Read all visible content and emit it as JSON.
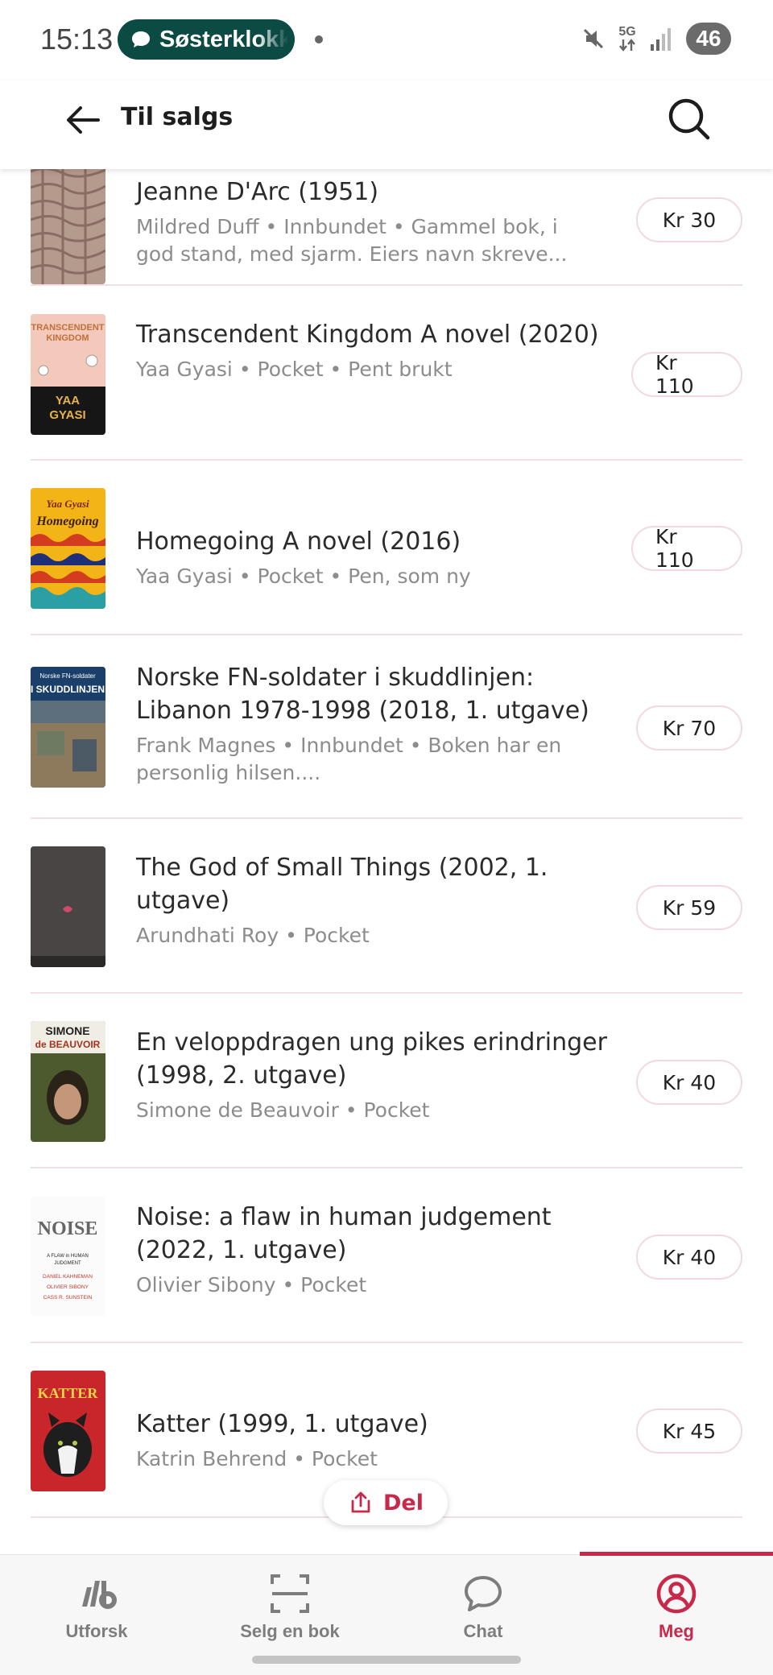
{
  "status_bar": {
    "time": "15:13",
    "notification_app": "Søsterklokken",
    "network": "5G",
    "battery": "46"
  },
  "header": {
    "title": "Til salgs"
  },
  "listings": [
    {
      "title": "Jeanne D'Arc (1951)",
      "meta": "Mildred Duff • Innbundet • Gammel bok, i god stand, med sjarm. Eiers navn skreve...",
      "price": "Kr 30",
      "cover": "jeanne-darc-cover"
    },
    {
      "title": "Transcendent Kingdom A novel (2020)",
      "meta": "Yaa Gyasi • Pocket • Pent brukt",
      "price": "Kr 110",
      "cover": "transcendent-kingdom-cover",
      "cover_text": [
        "TRANSCENDENT",
        "KINGDOM",
        "YAA",
        "GYASI"
      ]
    },
    {
      "title": "Homegoing A novel (2016)",
      "meta": "Yaa Gyasi • Pocket • Pen, som ny",
      "price": "Kr 110",
      "cover": "homegoing-cover",
      "cover_text": [
        "Yaa Gyasi",
        "Homegoing"
      ]
    },
    {
      "title": "Norske FN-soldater i skuddlinjen: Libanon 1978-1998 (2018, 1. utgave)",
      "meta": "Frank Magnes • Innbundet • Boken har en personlig hilsen....",
      "price": "Kr 70",
      "cover": "norske-fn-soldater-cover",
      "cover_text": [
        "Norske FN-soldater",
        "I SKUDDLINJEN"
      ]
    },
    {
      "title": "The God of Small Things (2002, 1. utgave)",
      "meta": "Arundhati Roy • Pocket",
      "price": "Kr 59",
      "cover": "god-of-small-things-cover"
    },
    {
      "title": "En veloppdragen ung pikes erindringer (1998, 2. utgave)",
      "meta": "Simone de Beauvoir • Pocket",
      "price": "Kr 40",
      "cover": "simone-de-beauvoir-cover",
      "cover_text": [
        "SIMONE",
        "de BEAUVOIR"
      ]
    },
    {
      "title": "Noise: a flaw in human judgement (2022, 1. utgave)",
      "meta": "Olivier Sibony • Pocket",
      "price": "Kr 40",
      "cover": "noise-cover",
      "cover_text": [
        "NOISE",
        "A FLAW in HUMAN",
        "JUDGMENT",
        "DANIEL KAHNEMAN",
        "OLIVIER SIBONY",
        "CASS R. SUNSTEIN"
      ]
    },
    {
      "title": "Katter (1999, 1. utgave)",
      "meta": "Katrin Behrend • Pocket",
      "price": "Kr 45",
      "cover": "katter-cover",
      "cover_text": [
        "KATTER"
      ]
    }
  ],
  "share_button": {
    "label": "Del",
    "icon": "share-icon"
  },
  "bottom_nav": [
    {
      "label": "Utforsk",
      "icon": "logo-icon",
      "active": false
    },
    {
      "label": "Selg en bok",
      "icon": "scan-icon",
      "active": false
    },
    {
      "label": "Chat",
      "icon": "chat-bubble-icon",
      "active": false
    },
    {
      "label": "Meg",
      "icon": "profile-icon",
      "active": true
    }
  ],
  "colors": {
    "accent": "#c8294b",
    "divider": "#f3dfe3",
    "pill": "#0c4a44"
  }
}
